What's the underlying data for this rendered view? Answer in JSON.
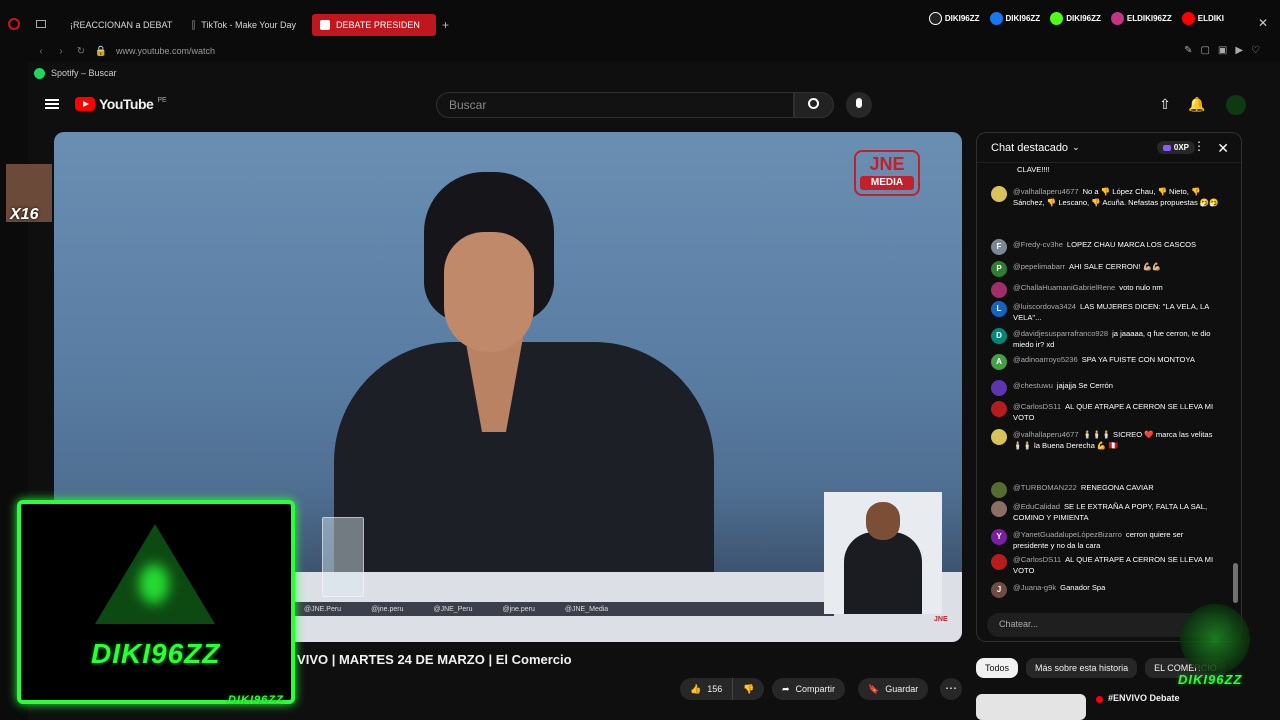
{
  "browser": {
    "tabs": [
      {
        "label": "¡REACCIONAN a DEBAT",
        "active": false
      },
      {
        "label": "TikTok - Make Your Day",
        "active": false
      },
      {
        "label": "DEBATE PRESIDEN",
        "active": true
      }
    ],
    "url": "www.youtube.com/watch",
    "bookmark": "Spotify – Buscar"
  },
  "socials": [
    {
      "label": "DIKI96ZZ",
      "icon": "tiktok-icon",
      "color": "#ffffff"
    },
    {
      "label": "DIKI96ZZ",
      "icon": "facebook-icon",
      "color": "#1877f2"
    },
    {
      "label": "DIKI96ZZ",
      "icon": "kick-icon",
      "color": "#53fc18"
    },
    {
      "label": "ELDIKI96ZZ",
      "icon": "instagram-icon",
      "color": "#c13584"
    },
    {
      "label": "ELDIKI",
      "icon": "youtube-icon",
      "color": "#ff0000"
    }
  ],
  "youtube": {
    "logo": "YouTube",
    "country": "PE",
    "search_placeholder": "Buscar"
  },
  "video": {
    "title": "2026 | | VIVO | MARTES 24 DE MARZO | El Comercio",
    "jne_logo": "JNE",
    "jne_sub": "MEDIA",
    "desk_tags": [
      "@JNE.Peru",
      "@jne.peru",
      "@JNE_Peru",
      "@jne.peru",
      "@JNE_Media"
    ],
    "corner": "JNE"
  },
  "actions": {
    "likes": "156",
    "share": "Compartir",
    "save": "Guardar"
  },
  "chat": {
    "header": "Chat destacado",
    "xp": "0XP",
    "placeholder": "Chatear...",
    "messages": [
      {
        "author": "",
        "text": "CLAVE!!!!",
        "initial": "",
        "color": "#555555"
      },
      {
        "author": "@valhallaperu4677",
        "text": "No a 👎 López Chau, 👎 Nieto, 👎 Sánchez, 👎 Lescano, 👎 Acuña. Nefastas propuestas 🤧🤧",
        "initial": "",
        "color": "#d8c35a"
      },
      {
        "author": "@Fredy-cv3he",
        "text": "LOPEZ CHAU MARCA LOS CASCOS",
        "initial": "F",
        "color": "#7b8794"
      },
      {
        "author": "@pepelimabarr",
        "text": "AHI SALE CERRON! 💪🏼💪🏼",
        "initial": "P",
        "color": "#2e7d32"
      },
      {
        "author": "@ChallaHuamaniGabrielRene",
        "text": "voto nulo nm",
        "initial": "",
        "color": "#a02e6a"
      },
      {
        "author": "@luiscordova3424",
        "text": "LAS MUJERES DICEN: \"LA VELA, LA VELA\"...",
        "initial": "L",
        "color": "#1565c0"
      },
      {
        "author": "@davidjesusparrafranco928",
        "text": "ja jaaaaa, q fue cerron, te dio miedo ir? xd",
        "initial": "D",
        "color": "#00897b"
      },
      {
        "author": "@adinoarroyo5236",
        "text": "SPA YA FUISTE CON MONTOYA",
        "initial": "A",
        "color": "#43a047"
      },
      {
        "author": "@chestuwu",
        "text": "jajajja Se Cerrón",
        "initial": "",
        "color": "#5e35b1"
      },
      {
        "author": "@CarlosDS11",
        "text": "AL QUE ATRAPE A CERRON SE LLEVA MI VOTO",
        "initial": "",
        "color": "#b71c1c"
      },
      {
        "author": "@valhallaperu4677",
        "text": "🕯️🕯️🕯️ SICREO ❤️ marca las velitas 🕯️🕯️ la Buena Derecha 💪 🇵🇪",
        "initial": "",
        "color": "#d8c35a"
      },
      {
        "author": "@TURBOMAN222",
        "text": "RENEGONA CAVIAR",
        "initial": "",
        "color": "#556b2f"
      },
      {
        "author": "@EduCalidad",
        "text": "SE LE EXTRAÑA A POPY, FALTA LA SAL, COMINO Y PIMIENTA",
        "initial": "",
        "color": "#8d6e63"
      },
      {
        "author": "@YanetGuadalupeLópezBizarro",
        "text": "cerron quiere ser presidente y no da la cara",
        "initial": "Y",
        "color": "#7b1fa2"
      },
      {
        "author": "@CarlosDS11",
        "text": "AL QUE ATRAPE A CERRON SE LLEVA MI VOTO",
        "initial": "",
        "color": "#b71c1c"
      },
      {
        "author": "@Juana-g9k",
        "text": "Ganador Spa",
        "initial": "J",
        "color": "#6d4c41"
      }
    ]
  },
  "chips": [
    "Todos",
    "Más sobre esta historia",
    "EL COMERCIO"
  ],
  "next_video": "#ENVIVO Debate",
  "overlay": {
    "brand": "DIKI96ZZ",
    "cam_badge": "X16"
  }
}
